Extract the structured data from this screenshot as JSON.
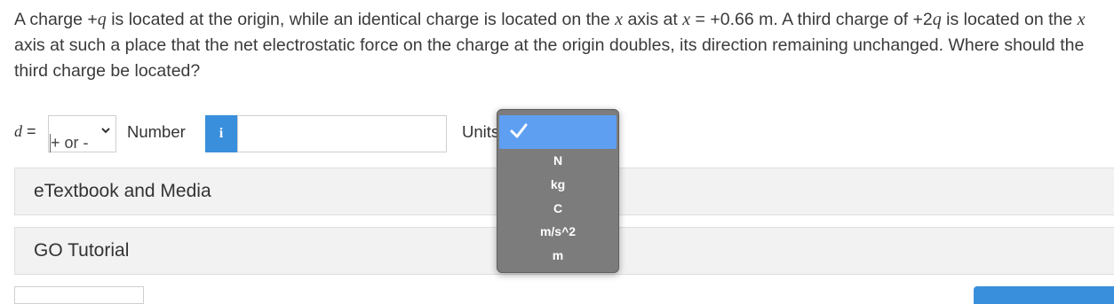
{
  "question": {
    "p1": "A charge +",
    "q1": "q",
    "p2": " is located at the origin, while an identical charge is located on the ",
    "x1": "x",
    "p3": " axis at ",
    "x2": "x",
    "p4": " = +0.66 m. A third charge of +2",
    "q2": "q",
    "p5": " is located on the ",
    "x3": "x",
    "p6": " axis at such a place that the net electrostatic force on the charge at the origin doubles, its direction remaining unchanged. Where should the third charge be located?"
  },
  "answer_row": {
    "var_name": "d",
    "equals": " =",
    "sign_select_value": "+ or -",
    "number_label": "Number",
    "info_icon_glyph": "i",
    "number_value": "",
    "units_label": "Units"
  },
  "units_dropdown": {
    "selected": "",
    "options": [
      "N",
      "kg",
      "C",
      "m/s^2",
      "m"
    ]
  },
  "accordions": [
    "eTextbook and Media",
    "GO Tutorial"
  ],
  "colors": {
    "accent": "#3a8fdc",
    "dropdown_bg": "#7c7c7c",
    "dropdown_selected": "#5e9ff2",
    "panel_bg": "#f2f2f2"
  }
}
